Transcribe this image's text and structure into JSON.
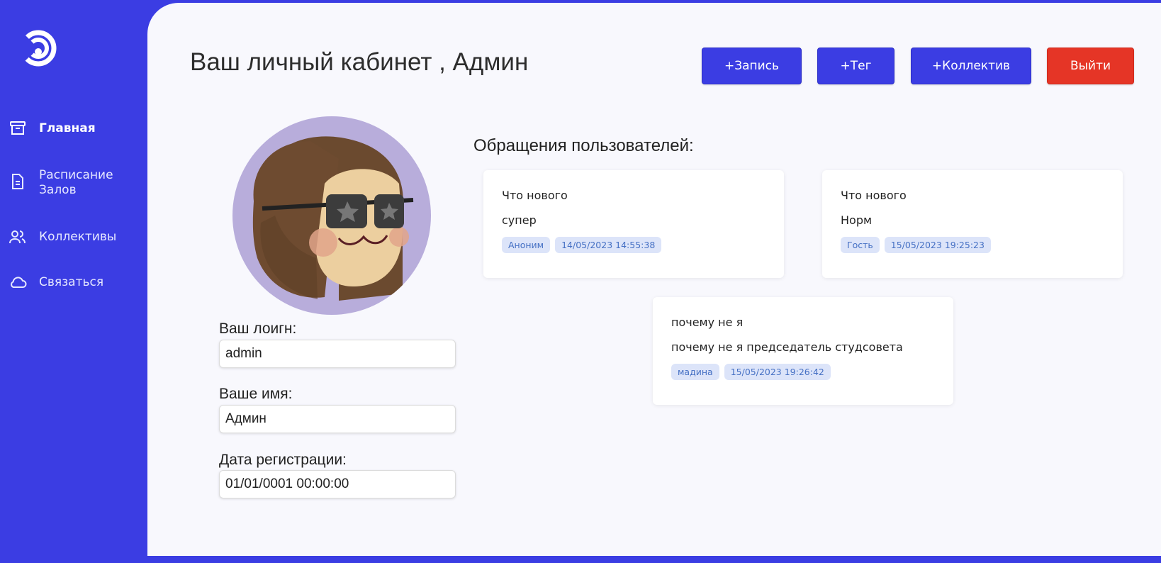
{
  "sidebar": {
    "items": [
      {
        "label": "Главная",
        "icon": "archive-icon",
        "active": true
      },
      {
        "label": "Расписание Залов",
        "icon": "document-icon",
        "active": false
      },
      {
        "label": "Коллективы",
        "icon": "users-icon",
        "active": false
      },
      {
        "label": "Связаться",
        "icon": "cloud-icon",
        "active": false
      }
    ]
  },
  "header": {
    "title": "Ваш личный кабинет , Админ",
    "buttons": {
      "add_record": "+Запись",
      "add_tag": "+Тег",
      "add_collective": "+Коллектив",
      "logout": "Выйти"
    }
  },
  "profile": {
    "login_label": "Ваш лоигн:",
    "login_value": "admin",
    "name_label": "Ваше имя:",
    "name_value": "Админ",
    "reg_label": "Дата регистрации:",
    "reg_value": "01/01/0001 00:00:00"
  },
  "requests": {
    "title": "Обращения пользователей:",
    "items": [
      {
        "title": "Что нового",
        "text": "супер",
        "author": "Аноним",
        "date": "14/05/2023 14:55:38"
      },
      {
        "title": "Что нового",
        "text": "Норм",
        "author": "Гость",
        "date": "15/05/2023 19:25:23"
      },
      {
        "title": "почему не я",
        "text": "почему не я председатель студсовета",
        "author": "мадина",
        "date": "15/05/2023 19:26:42"
      }
    ]
  },
  "colors": {
    "brand": "#3b3de3",
    "danger": "#e53526",
    "tag_bg": "#dce4f9",
    "tag_text": "#4570c4"
  }
}
